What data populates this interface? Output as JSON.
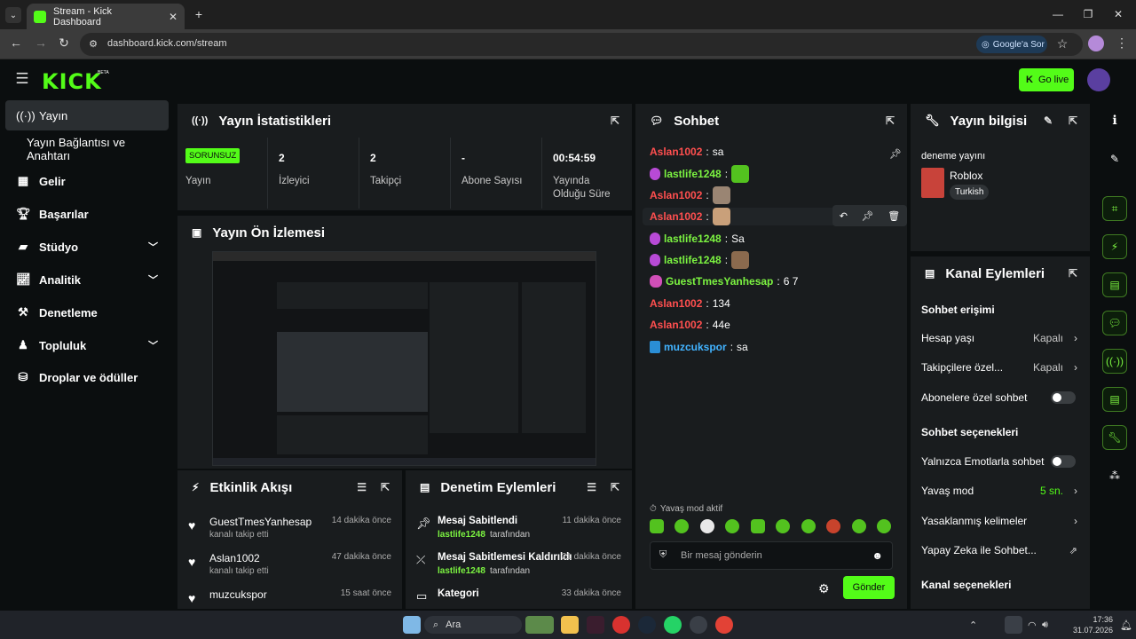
{
  "browser": {
    "tab_title": "Stream - Kick Dashboard",
    "url": "dashboard.kick.com/stream",
    "google_lens": "Google'a Sor"
  },
  "app": {
    "logo": "KICK",
    "logo_sup": "BETA",
    "go_live": "Go live"
  },
  "sidebar": {
    "items": [
      {
        "label": "Yayın",
        "icon": "broadcast-icon"
      },
      {
        "label": "Yayın Bağlantısı ve Anahtarı",
        "icon": ""
      },
      {
        "label": "Gelir",
        "icon": "revenue-icon"
      },
      {
        "label": "Başarılar",
        "icon": "trophy-icon"
      },
      {
        "label": "Stüdyo",
        "icon": "studio-icon"
      },
      {
        "label": "Analitik",
        "icon": "analytics-icon"
      },
      {
        "label": "Denetleme",
        "icon": "moderation-icon"
      },
      {
        "label": "Topluluk",
        "icon": "community-icon"
      },
      {
        "label": "Droplar ve ödüller",
        "icon": "drops-icon"
      }
    ]
  },
  "stats": {
    "title": "Yayın İstatistikleri",
    "status": "SORUNSUZ",
    "status_label": "Yayın",
    "viewers": "2",
    "viewers_label": "İzleyici",
    "followers": "2",
    "followers_label": "Takipçi",
    "subs": "-",
    "subs_label": "Abone Sayısı",
    "uptime": "00:54:59",
    "uptime_label_1": "Yayında",
    "uptime_label_2": "Olduğu Süre"
  },
  "preview": {
    "title": "Yayın Ön İzlemesi"
  },
  "activity": {
    "title": "Etkinlik Akışı",
    "items": [
      {
        "name": "GuestTmesYanhesap",
        "sub": "kanalı takip etti",
        "time": "14 dakika önce"
      },
      {
        "name": "Aslan1002",
        "sub": "kanalı takip etti",
        "time": "47 dakika önce"
      },
      {
        "name": "muzcukspor",
        "sub": "",
        "time": "15 saat önce"
      }
    ]
  },
  "modactions": {
    "title": "Denetim Eylemleri",
    "items": [
      {
        "name": "Mesaj Sabitlendi",
        "user": "lastlife1248",
        "suffix": "tarafından",
        "time": "11 dakika önce"
      },
      {
        "name": "Mesaj Sabitlemesi Kaldırıldı",
        "user": "lastlife1248",
        "suffix": "tarafından",
        "time": "21 dakika önce"
      },
      {
        "name": "Kategori",
        "user": "",
        "suffix": "",
        "time": "33 dakika önce"
      }
    ]
  },
  "chat": {
    "title": "Sohbet",
    "messages": [
      {
        "user": "Aslan1002",
        "text": "sa",
        "color": "#ff4f4f"
      },
      {
        "user": "lastlife1248",
        "text": "",
        "color": "#7cf441"
      },
      {
        "user": "Aslan1002",
        "text": "",
        "color": "#ff4f4f"
      },
      {
        "user": "Aslan1002",
        "text": "",
        "color": "#ff4f4f"
      },
      {
        "user": "lastlife1248",
        "text": "Sa",
        "color": "#7cf441"
      },
      {
        "user": "lastlife1248",
        "text": "",
        "color": "#7cf441"
      },
      {
        "user": "GuestTmesYanhesap",
        "text": "6 7",
        "color": "#7cf441"
      },
      {
        "user": "Aslan1002",
        "text": "134",
        "color": "#ff4f4f"
      },
      {
        "user": "Aslan1002",
        "text": "44e",
        "color": "#ff4f4f"
      },
      {
        "user": "muzcukspor",
        "text": "sa",
        "color": "#42b3ff"
      }
    ],
    "slow_mode": "Yavaş mod aktif",
    "placeholder": "Bir mesaj gönderin",
    "send": "Gönder"
  },
  "info": {
    "title": "Yayın bilgisi",
    "stream_title": "deneme yayını",
    "category": "Roblox",
    "language": "Turkish"
  },
  "channel": {
    "title": "Kanal Eylemleri",
    "chat_access": "Sohbet erişimi",
    "account_age": "Hesap yaşı",
    "account_age_val": "Kapalı",
    "followers_only": "Takipçilere özel...",
    "followers_only_val": "Kapalı",
    "subs_only": "Abonelere özel sohbet",
    "chat_options": "Sohbet seçenekleri",
    "emotes_only": "Yalnızca Emotlarla sohbet",
    "slow_mode": "Yavaş mod",
    "slow_mode_val": "5 sn.",
    "banned_words": "Yasaklanmış kelimeler",
    "ai_chat": "Yapay Zeka ile Sohbet...",
    "channel_options": "Kanal seçenekleri"
  },
  "taskbar": {
    "search": "Ara",
    "time": "17:36",
    "date": "31.07.2026"
  },
  "colors": {
    "accent": "#53fc18",
    "panel": "#191c1e",
    "bg": "#0b0e0f"
  }
}
